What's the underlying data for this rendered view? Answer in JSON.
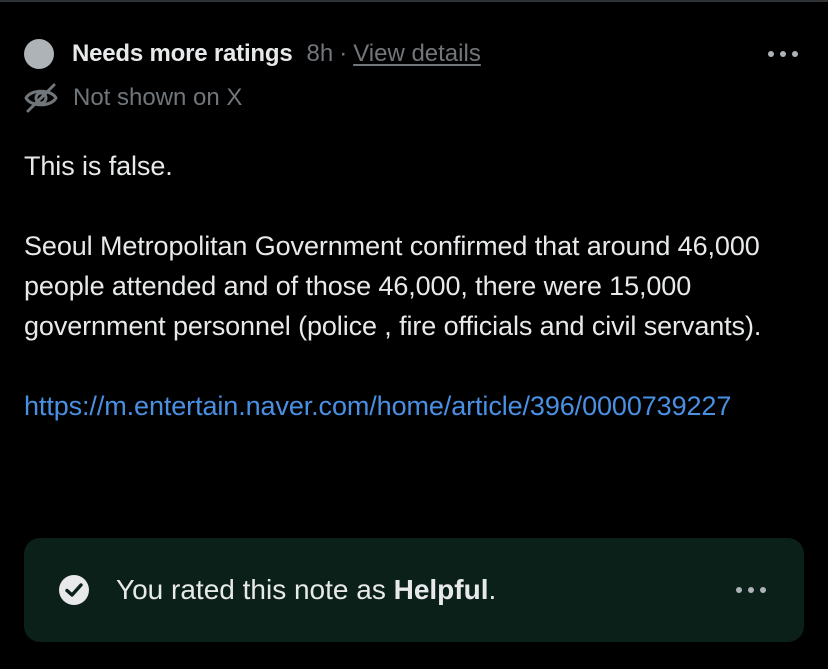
{
  "note": {
    "status_label": "Needs more ratings",
    "age": "8h",
    "separator": "·",
    "details_link": "View details",
    "visibility": "Not shown on X",
    "more_icon": "ellipsis-horizontal-icon",
    "hidden_icon": "eye-slash-icon"
  },
  "body": {
    "paragraph_1": "This is false.",
    "paragraph_2": "Seoul Metropolitan Government confirmed that around 46,000 people attended and of those 46,000, there were 15,000 government personnel (police , fire officials and civil servants).",
    "link": "https://m.entertain.naver.com/home/article/396/0000739227"
  },
  "rating": {
    "text_prefix": "You rated this note as ",
    "rating_value": "Helpful",
    "text_suffix": ".",
    "check_icon": "check-circle-icon",
    "more_icon": "ellipsis-horizontal-icon"
  },
  "colors": {
    "background": "#000000",
    "primary_text": "#e7e9ea",
    "secondary_text": "#71767b",
    "link": "#4a90e2",
    "status_dot": "#aeb3b8",
    "rating_card_bg": "#0b2018"
  }
}
